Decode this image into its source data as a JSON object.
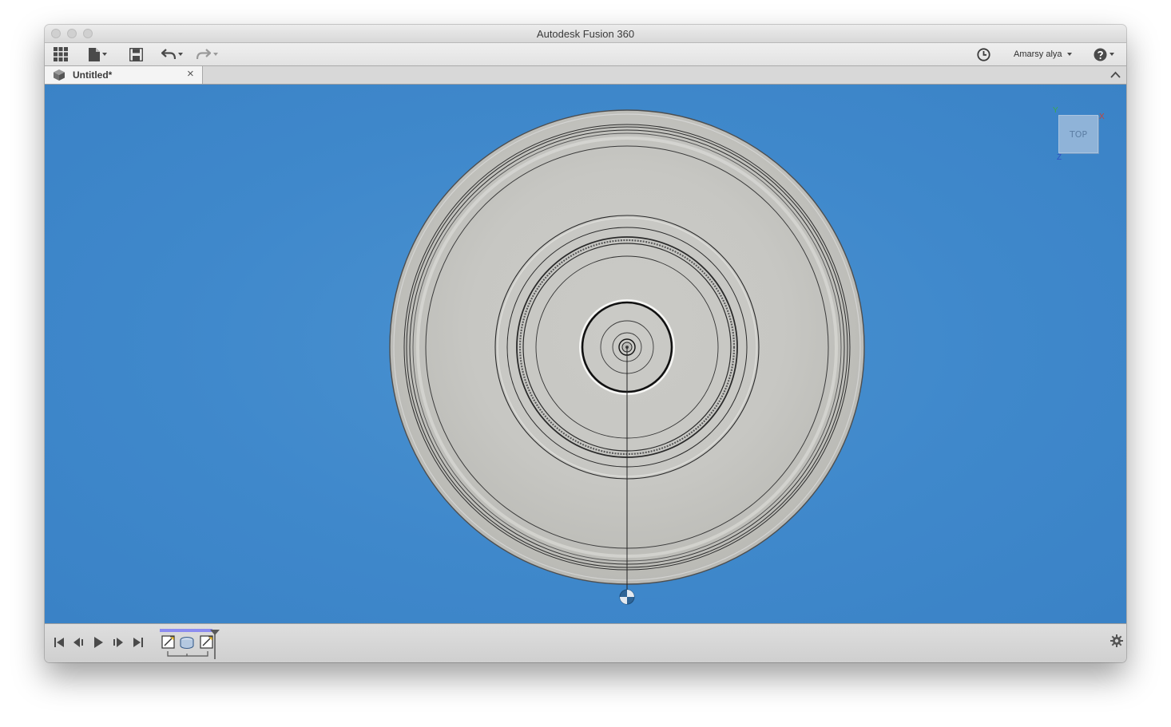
{
  "window": {
    "title": "Autodesk Fusion 360"
  },
  "toolbar": {
    "user_name": "Amarsy alya",
    "icons": [
      "grid-icon",
      "file-icon",
      "save-icon",
      "undo-icon",
      "redo-icon",
      "clock-icon",
      "help-icon"
    ]
  },
  "tabs": [
    {
      "label": "Untitled*",
      "close": "×"
    }
  ],
  "viewcube": {
    "face_label": "TOP",
    "axes": [
      "Y",
      "X",
      "Z"
    ]
  },
  "timeline": {
    "controls": [
      "skip-start",
      "step-back",
      "play",
      "step-forward",
      "skip-end"
    ],
    "features": [
      "sketch",
      "revolve",
      "sketch"
    ]
  },
  "colors": {
    "viewport_bg": "#3f88cb",
    "model_fill": "#c8c8c4",
    "accent_timeline": "#8c8cf0"
  }
}
